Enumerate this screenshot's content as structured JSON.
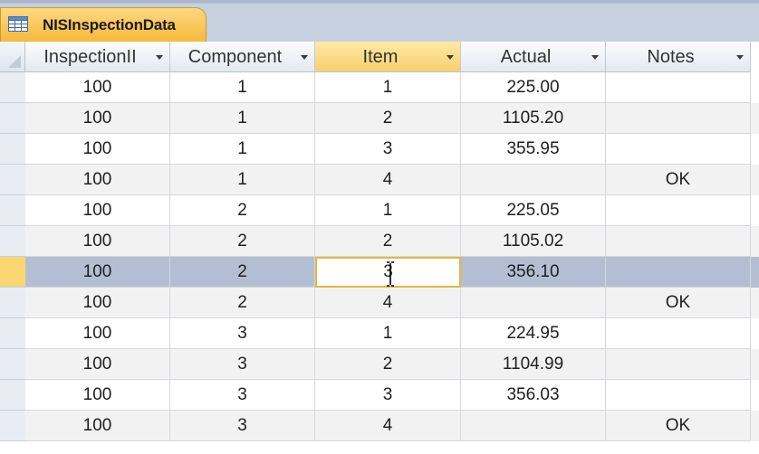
{
  "tab": {
    "title": "NISInspectionData",
    "icon": "table-icon"
  },
  "columns": [
    "InspectionII",
    "Component",
    "Item",
    "Actual",
    "Notes"
  ],
  "sorted_column": "Item",
  "rows": [
    [
      "100",
      "1",
      "1",
      "225.00",
      ""
    ],
    [
      "100",
      "1",
      "2",
      "1105.20",
      ""
    ],
    [
      "100",
      "1",
      "3",
      "355.95",
      ""
    ],
    [
      "100",
      "1",
      "4",
      "",
      "OK"
    ],
    [
      "100",
      "2",
      "1",
      "225.05",
      ""
    ],
    [
      "100",
      "2",
      "2",
      "1105.02",
      ""
    ],
    [
      "100",
      "2",
      "3",
      "356.10",
      ""
    ],
    [
      "100",
      "2",
      "4",
      "",
      "OK"
    ],
    [
      "100",
      "3",
      "1",
      "224.95",
      ""
    ],
    [
      "100",
      "3",
      "2",
      "1104.99",
      ""
    ],
    [
      "100",
      "3",
      "3",
      "356.03",
      ""
    ],
    [
      "100",
      "3",
      "4",
      "",
      "OK"
    ]
  ],
  "selected_row": 6,
  "editing_column": 2,
  "colors": {
    "tab_accent": "#f6b93a",
    "selected_row": "#b4bed3",
    "current_row_marker": "#f9d770"
  }
}
